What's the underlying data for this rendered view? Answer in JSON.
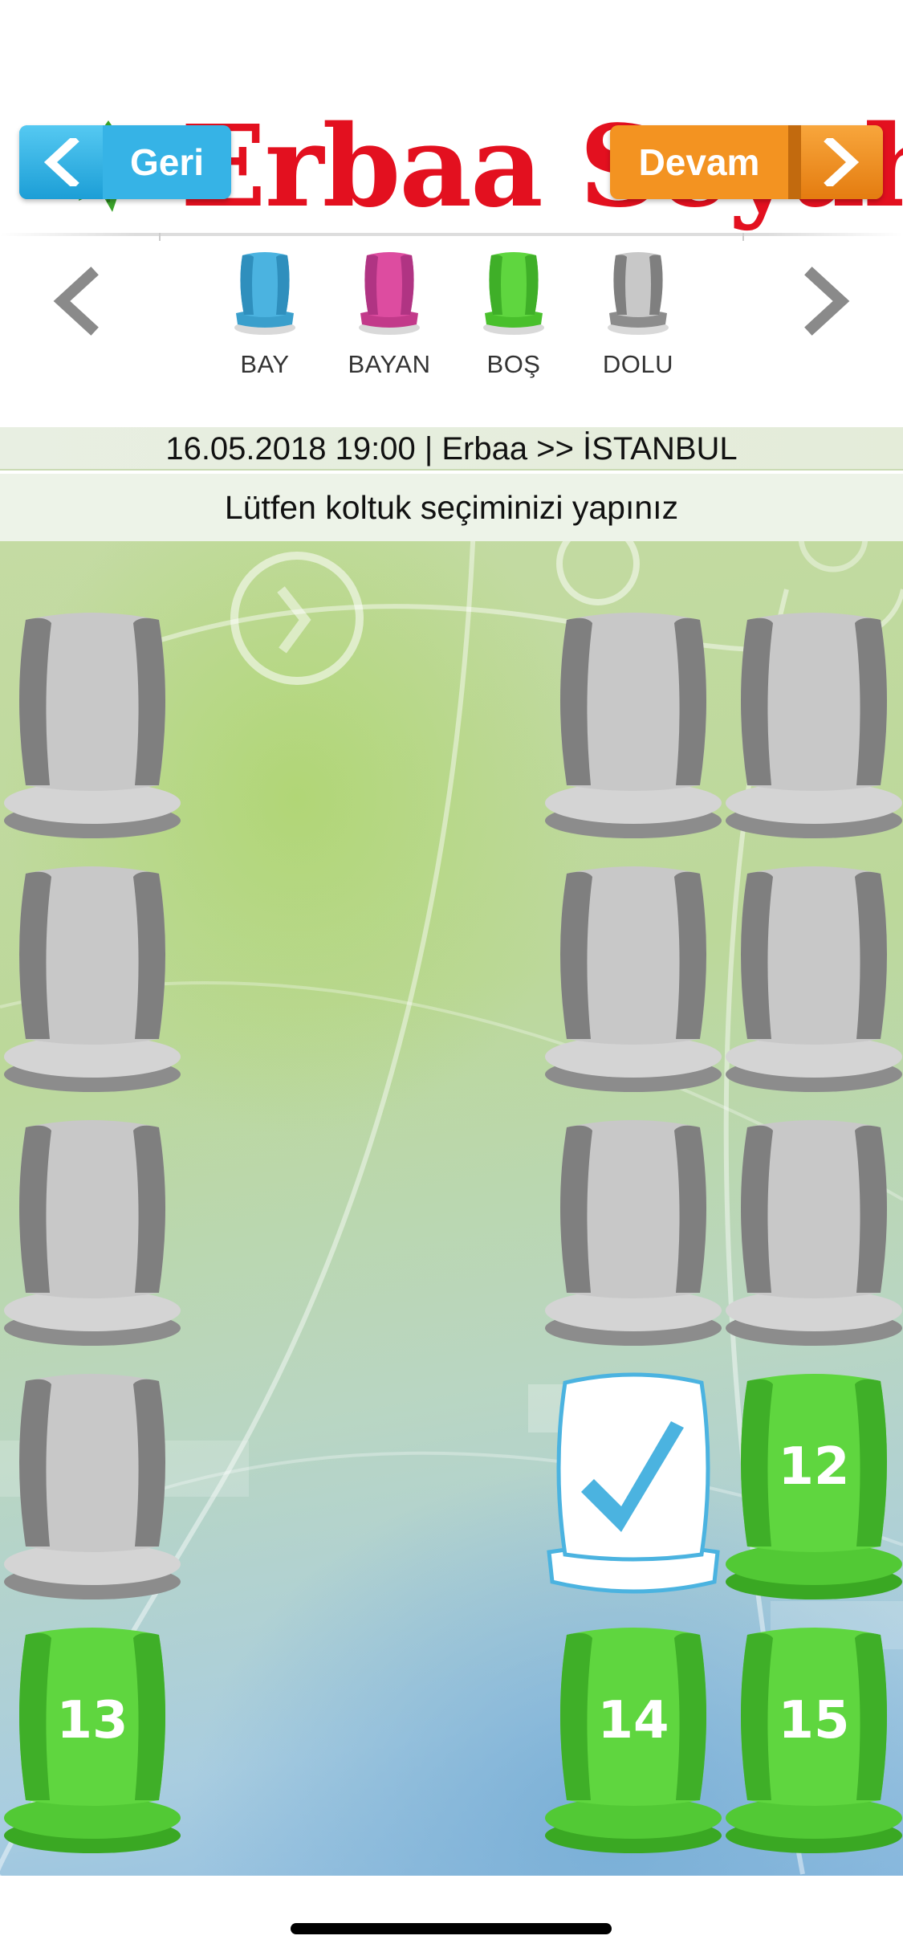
{
  "header": {
    "brand": "Erbaa Seyahat",
    "back_label": "Geri",
    "next_label": "Devam"
  },
  "legend": {
    "items": [
      {
        "key": "male",
        "label": "BAY",
        "color": "#4bb3e0"
      },
      {
        "key": "female",
        "label": "BAYAN",
        "color": "#dd4ca0"
      },
      {
        "key": "empty",
        "label": "BOŞ",
        "color": "#5fd63f"
      },
      {
        "key": "occupied",
        "label": "DOLU",
        "color": "#9b9b9b"
      }
    ]
  },
  "trip": {
    "info": "16.05.2018 19:00 | Erbaa >> İSTANBUL",
    "instruction": "Lütfen koltuk seçiminizi yapınız"
  },
  "colors": {
    "occupied_back": "#c8c8c8",
    "occupied_side": "#7f7f7f",
    "empty_back": "#5fd63f",
    "empty_side": "#3faf28",
    "selected_border": "#4bb3e0",
    "accent_orange": "#f39321",
    "accent_blue": "#36b3e6"
  },
  "seats": [
    {
      "number": "",
      "status": "occupied"
    },
    {
      "number": "",
      "status": "occupied"
    },
    {
      "number": "",
      "status": "occupied"
    },
    {
      "number": "",
      "status": "occupied"
    },
    {
      "number": "",
      "status": "occupied"
    },
    {
      "number": "",
      "status": "occupied"
    },
    {
      "number": "",
      "status": "occupied"
    },
    {
      "number": "",
      "status": "occupied"
    },
    {
      "number": "",
      "status": "occupied"
    },
    {
      "number": "",
      "status": "selected"
    },
    {
      "number": "12",
      "status": "empty"
    },
    {
      "number": "13",
      "status": "empty"
    },
    {
      "number": "14",
      "status": "empty"
    },
    {
      "number": "15",
      "status": "empty"
    }
  ]
}
